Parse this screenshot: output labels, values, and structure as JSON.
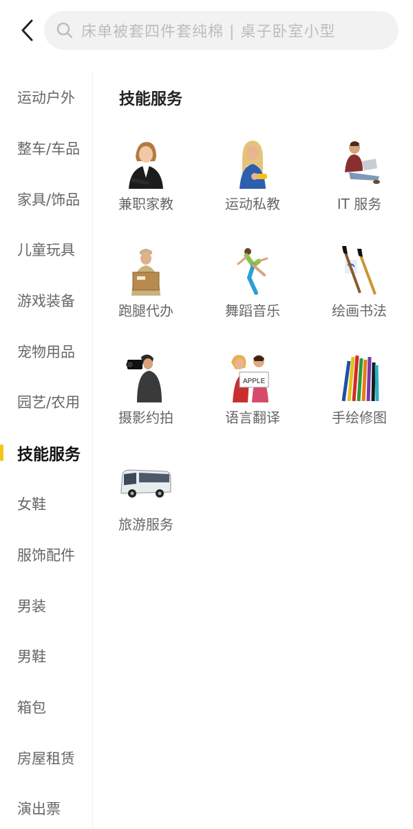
{
  "header": {
    "back_icon": "chevron-left-icon",
    "search_icon": "search-icon",
    "search_placeholder": "床单被套四件套纯棉 | 桌子卧室小型"
  },
  "sidebar": {
    "accent_color": "#f5c518",
    "active_index": 7,
    "items": [
      {
        "label": "运动户外"
      },
      {
        "label": "整车/车品"
      },
      {
        "label": "家具/饰品"
      },
      {
        "label": "儿童玩具"
      },
      {
        "label": "游戏装备"
      },
      {
        "label": "宠物用品"
      },
      {
        "label": "园艺/农用"
      },
      {
        "label": "技能服务"
      },
      {
        "label": "女鞋"
      },
      {
        "label": "服饰配件"
      },
      {
        "label": "男装"
      },
      {
        "label": "男鞋"
      },
      {
        "label": "箱包"
      },
      {
        "label": "房屋租赁"
      },
      {
        "label": "演出票"
      }
    ]
  },
  "main": {
    "section_title": "技能服务",
    "tiles": [
      {
        "label": "兼职家教",
        "icon": "tutor-woman-photo"
      },
      {
        "label": "运动私教",
        "icon": "fitness-trainer-photo"
      },
      {
        "label": "IT 服务",
        "icon": "man-with-laptop-photo"
      },
      {
        "label": "跑腿代办",
        "icon": "delivery-man-box-photo"
      },
      {
        "label": "舞蹈音乐",
        "icon": "dancer-photo"
      },
      {
        "label": "绘画书法",
        "icon": "calligraphy-brushes-photo"
      },
      {
        "label": "摄影约拍",
        "icon": "photographer-camera-photo"
      },
      {
        "label": "语言翻译",
        "icon": "apple-sign-kids-photo"
      },
      {
        "label": "手绘修图",
        "icon": "colored-pencils-photo"
      },
      {
        "label": "旅游服务",
        "icon": "tour-bus-photo"
      }
    ],
    "apple_sign_text": "APPLE"
  }
}
